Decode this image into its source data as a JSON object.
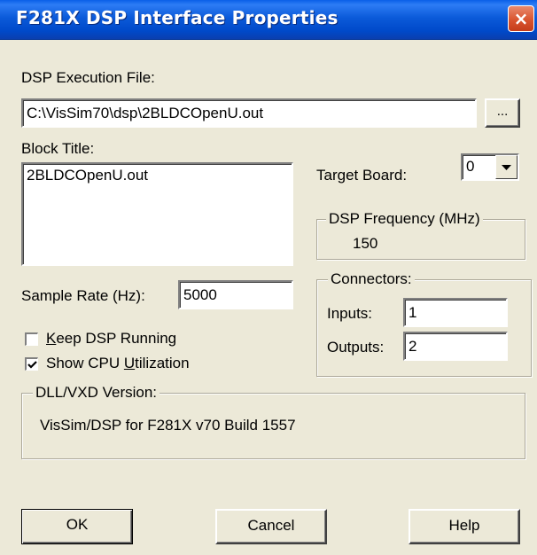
{
  "window": {
    "title": "F281X DSP Interface Properties",
    "close_label": "×"
  },
  "exec_file": {
    "label": "DSP Execution File:",
    "value": "C:\\VisSim70\\dsp\\2BLDCOpenU.out",
    "browse_label": "..."
  },
  "block_title": {
    "label": "Block Title:",
    "value": "2BLDCOpenU.out"
  },
  "target_board": {
    "label": "Target Board:",
    "value": "0"
  },
  "dsp_frequency": {
    "label": "DSP Frequency (MHz)",
    "value": "150"
  },
  "sample_rate": {
    "label": "Sample Rate (Hz):",
    "value": "5000"
  },
  "connectors": {
    "label": "Connectors:",
    "inputs_label": "Inputs:",
    "inputs_value": "1",
    "outputs_label": "Outputs:",
    "outputs_value": "2"
  },
  "options": {
    "keep_running": {
      "label_pre": "",
      "label_key": "K",
      "label_post": "eep DSP Running",
      "checked": false
    },
    "show_cpu": {
      "label_pre": "Show CPU ",
      "label_key": "U",
      "label_post": "tilization",
      "checked": true
    }
  },
  "dll_version": {
    "label": "DLL/VXD Version:",
    "value": "VisSim/DSP for F281X v70 Build 1557"
  },
  "buttons": {
    "ok": "OK",
    "cancel": "Cancel",
    "help": "Help"
  }
}
